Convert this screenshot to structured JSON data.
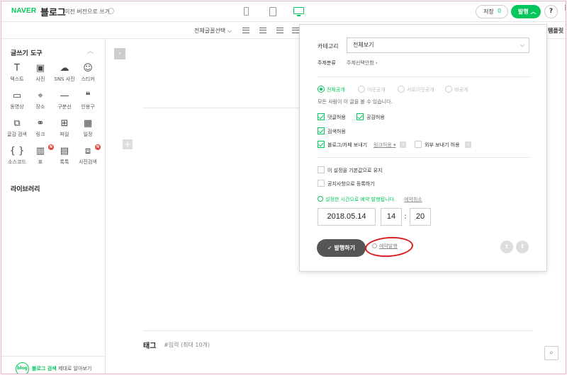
{
  "header": {
    "brand": "NAVER",
    "app_title": "블로그",
    "old_version_link": "이전 버전으로 쓰기",
    "save_label": "저장",
    "save_count": "0",
    "publish_label": "발행",
    "help_label": "?",
    "more_label": "⋮"
  },
  "toolbar": {
    "font_select": "전체글꼴선택",
    "template_label": "템플릿"
  },
  "sidebar": {
    "title": "글쓰기 도구",
    "collapse": "︿",
    "tools": [
      {
        "icon": "T",
        "label": "텍스트"
      },
      {
        "icon": "▣",
        "label": "사진"
      },
      {
        "icon": "☁",
        "label": "SNS 사진"
      },
      {
        "icon": "☺",
        "label": "스티커"
      },
      {
        "icon": "▭",
        "label": "동영상"
      },
      {
        "icon": "⌖",
        "label": "장소"
      },
      {
        "icon": "—",
        "label": "구분선"
      },
      {
        "icon": "❝",
        "label": "인용구"
      },
      {
        "icon": "⧉",
        "label": "글감 검색"
      },
      {
        "icon": "⚭",
        "label": "링크"
      },
      {
        "icon": "⊞",
        "label": "파일"
      },
      {
        "icon": "▦",
        "label": "일정"
      },
      {
        "icon": "{ }",
        "label": "소스코드"
      },
      {
        "icon": "▥",
        "label": "표"
      },
      {
        "icon": "▤",
        "label": "톡톡"
      },
      {
        "icon": "⧈",
        "label": "사진검색"
      }
    ],
    "new_badge": "N",
    "library_title": "라이브러리",
    "footer_badge": "blog",
    "footer_search": "블로그 검색",
    "footer_rest": "제대로 알아보기"
  },
  "editor": {
    "collapse_arrow": "‹",
    "add_button": "+",
    "tag_label": "태그",
    "tag_placeholder": "#입력 (최대 10개)"
  },
  "dialog": {
    "category_label": "카테고리",
    "category_value": "전체보기",
    "topic_label": "주제분류",
    "topic_value": "주제선택안함 ›",
    "visibility_options": [
      {
        "label": "전체공개",
        "selected": true
      },
      {
        "label": "이웃공개",
        "selected": false
      },
      {
        "label": "서로이웃공개",
        "selected": false
      },
      {
        "label": "비공개",
        "selected": false
      }
    ],
    "visibility_note": "모든 사람이 이 글을 볼 수 있습니다.",
    "allow_comments": "댓글허용",
    "allow_likes": "공감허용",
    "allow_search": "검색허용",
    "allow_share": "블로그/카페 보내기",
    "link_permission": "링크허용",
    "external_share": "외부 보내기 허용",
    "keep_default": "이 설정을 기본값으로 유지",
    "register_notice": "공지사항으로 등록하기",
    "schedule_msg": "설정한 시간으로 예약 발행됩니다.",
    "schedule_cancel": "예약취소",
    "date": "2018.05.14",
    "hour": "14",
    "minute": "20",
    "colon": ":",
    "publish_button": "발행하기",
    "reserve_link": "예약발행",
    "twitter": "t",
    "facebook": "f"
  },
  "colors": {
    "accent": "#03c75a",
    "highlight_ellipse": "#d81e1e"
  }
}
